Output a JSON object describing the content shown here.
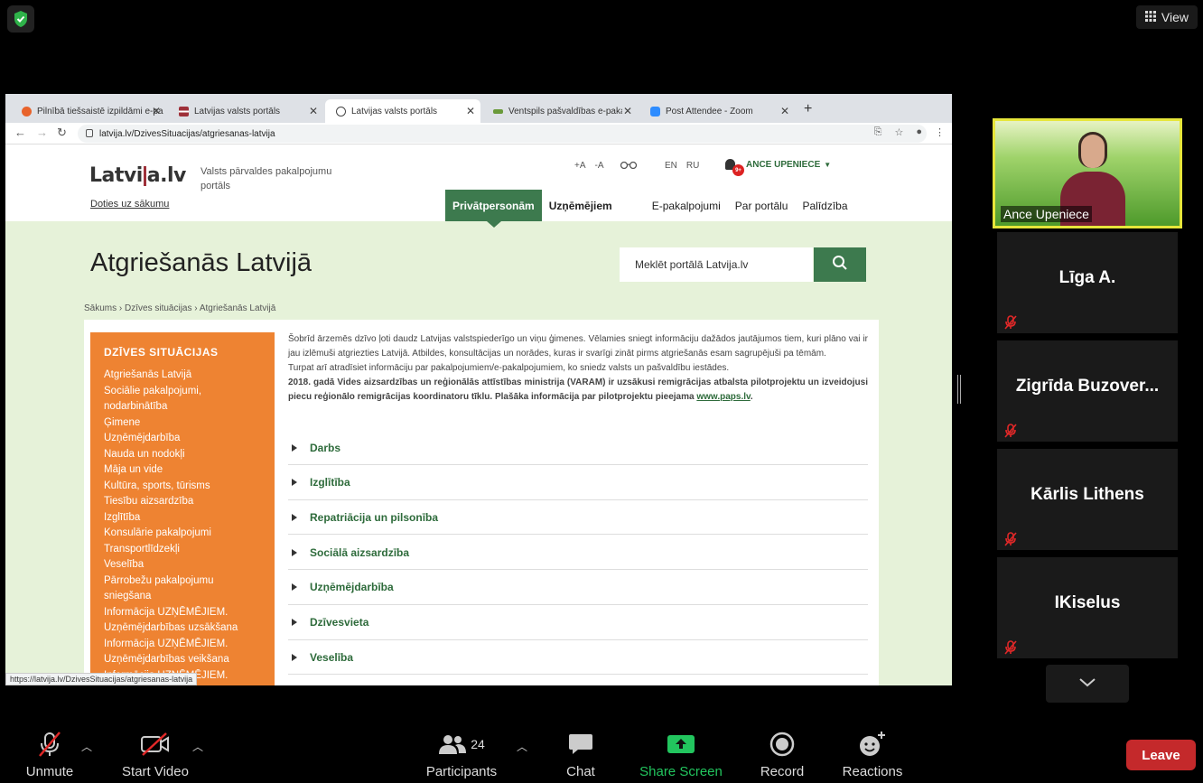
{
  "zoom": {
    "view_label": "View",
    "toolbar": {
      "unmute": "Unmute",
      "start_video": "Start Video",
      "participants": "Participants",
      "participants_count": "24",
      "chat": "Chat",
      "share_screen": "Share Screen",
      "record": "Record",
      "reactions": "Reactions",
      "leave": "Leave"
    },
    "participants": [
      {
        "name": "Ance Upeniece",
        "video": true
      },
      {
        "name": "Līga A.",
        "muted": true
      },
      {
        "name": "Zigrīda  Buzover...",
        "muted": true
      },
      {
        "name": "Kārlis Lithens",
        "muted": true
      },
      {
        "name": "IKiselus",
        "muted": true
      }
    ]
  },
  "browser": {
    "tabs": [
      {
        "title": "Pilnībā tiešsaistē izpildāmi e-pa",
        "color": "#e8632b"
      },
      {
        "title": "Latvijas valsts portāls",
        "color": "#9e3039"
      },
      {
        "title": "Latvijas valsts portāls",
        "color": "#444444",
        "active": true
      },
      {
        "title": "Ventspils pašvaldības e-pakalp",
        "color": "#6a9a3a"
      },
      {
        "title": "Post Attendee - Zoom",
        "color": "#2d8cff"
      }
    ],
    "url": "latvija.lv/DzivesSituacijas/atgriesanas-latvija",
    "status_url": "https://latvija.lv/DzivesSituacijas/atgriesanas-latvija"
  },
  "site": {
    "logo": "Latvija.lv",
    "tagline": "Valsts pārvaldes pakalpojumu portāls",
    "home_link": "Doties uz sākumu",
    "font_larger": "+A",
    "font_smaller": "-A",
    "lang_en": "EN",
    "lang_ru": "RU",
    "user_name": "ANCE UPENIECE",
    "user_badge": "9+",
    "nav": [
      "Privātpersonām",
      "Uzņēmējiem",
      "E-pakalpojumi",
      "Par portālu",
      "Palīdzība"
    ],
    "page_title": "Atgriešanās Latvijā",
    "search_placeholder": "Meklēt portālā Latvija.lv",
    "breadcrumb": "Sākums ›  Dzīves situācijas ›  Atgriešanās Latvijā",
    "sidebar_title": "DZĪVES SITUĀCIJAS",
    "sidebar_items": [
      "Atgriešanās Latvijā",
      "Sociālie pakalpojumi, nodarbinātība",
      "Ģimene",
      "Uzņēmējdarbība",
      "Nauda un nodokļi",
      "Māja un vide",
      "Kultūra, sports, tūrisms",
      "Tiesību aizsardzība",
      "Izglītība",
      "Konsulārie pakalpojumi",
      "Transportlīdzekļi",
      "Veselība",
      "Pārrobežu pakalpojumu sniegšana",
      "Informācija UZŅĒMĒJIEM.",
      "Uzņēmējdarbības uzsākšana",
      "Informācija UZŅĒMĒJIEM.",
      "Uzņēmējdarbības veikšana",
      "Informācija UZŅĒMĒJIEM."
    ],
    "intro_p1": "Šobrīd ārzemēs dzīvo ļoti daudz Latvijas valstspiederīgo un viņu ģimenes. Vēlamies sniegt informāciju dažādos jautājumos tiem, kuri plāno vai ir jau izlēmuši atgriezties Latvijā. Atbildes, konsultācijas un norādes, kuras ir svarīgi zināt pirms atgriešanās esam sagrupējuši pa tēmām.",
    "intro_p2": "Turpat arī atradīsiet informāciju par pakalpojumiem/e-pakalpojumiem, ko sniedz valsts un pašvaldību iestādes.",
    "intro_p3": "2018. gadā Vides aizsardzības un reģionālās attīstības ministrija (VARAM) ir uzsākusi remigrācijas atbalsta pilotprojektu un izveidojusi piecu reģionālo remigrācijas koordinatoru tīklu. Plašāka informācija par pilotprojektu pieejama ",
    "intro_link": "www.paps.lv",
    "intro_end": ".",
    "accordion": [
      "Darbs",
      "Izglītība",
      "Repatriācija un pilsonība",
      "Sociālā aizsardzība",
      "Uzņēmējdarbība",
      "Dzīvesvieta",
      "Veselība"
    ]
  },
  "colors": {
    "site_green": "#3d7a4e",
    "sidebar_orange": "#ee8332",
    "leave_red": "#c4292b",
    "share_green": "#22c55e"
  }
}
